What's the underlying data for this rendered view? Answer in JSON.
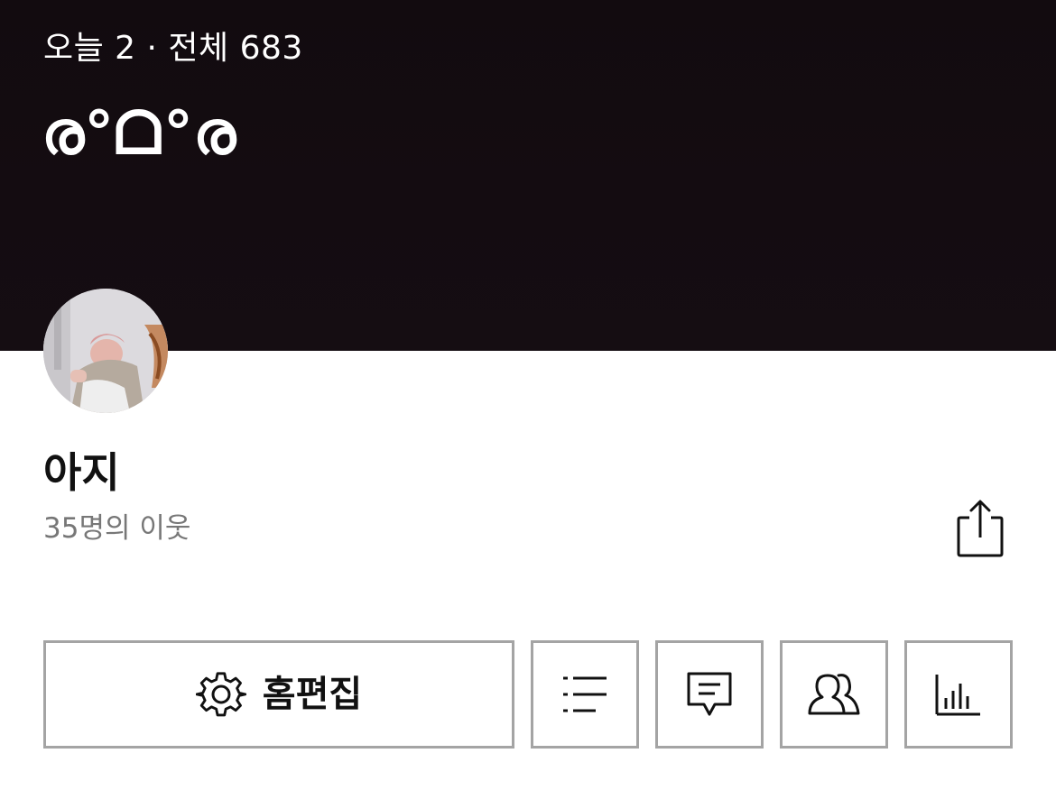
{
  "header": {
    "visit_stats": "오늘 2 · 전체 683",
    "blog_title": "ര°ᗝ°ര"
  },
  "profile": {
    "name": "아지",
    "neighbors": "35명의 이웃"
  },
  "actions": {
    "edit_label": "홈편집"
  },
  "icons": {
    "share": "share-icon",
    "settings": "gear-icon",
    "list": "list-icon",
    "comment": "comment-icon",
    "neighbor": "people-icon",
    "stats": "bar-chart-icon"
  },
  "colors": {
    "cover_background": "#140c11",
    "button_border": "#a4a4a4",
    "secondary_text": "#777777"
  }
}
